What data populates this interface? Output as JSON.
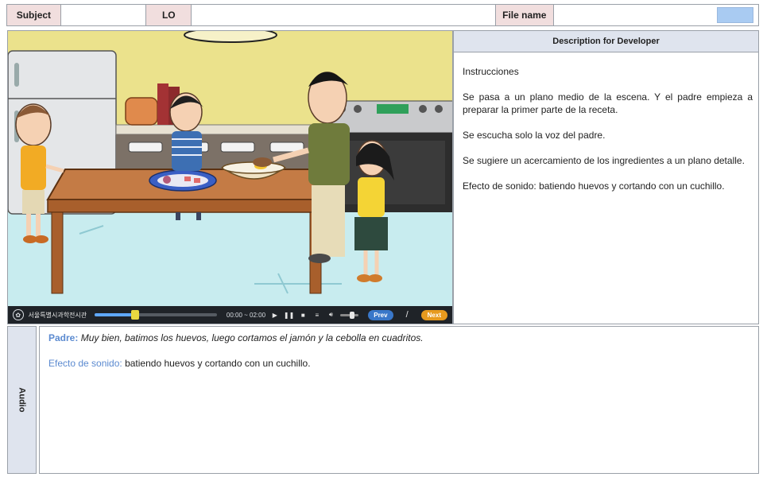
{
  "header": {
    "subject_label": "Subject",
    "lo_label": "LO",
    "filename_label": "File name"
  },
  "player": {
    "brand": "서울특별시과학전시관",
    "time": "00:00 ~ 02:00",
    "progress": 0.32,
    "prev_label": "Prev",
    "separator": "/",
    "next_label": "Next"
  },
  "description": {
    "heading": "Description for Developer",
    "paragraphs": [
      "Instrucciones",
      "Se pasa a un plano medio de la escena. Y el padre empieza a preparar  la primer parte de la receta.",
      "Se escucha solo la voz del padre.",
      "Se sugiere un acercamiento de los ingredientes a un plano detalle.",
      "Efecto de sonido:  batiendo huevos y cortando con un cuchillo."
    ]
  },
  "audio": {
    "tab_label": "Audio",
    "speaker": "Padre:",
    "line": " Muy bien, batimos los huevos, luego cortamos el jamón y la cebolla en cuadritos.",
    "sfx_label": "Efecto de sonido:",
    "sfx_text": "  batiendo huevos y cortando con un cuchillo."
  },
  "colors": {
    "header_label_bg": "#f1dede",
    "panel_header_bg": "#dfe4ee",
    "swatch": "#a9cbf2",
    "accent_text": "#5b8ad0",
    "prev_button": "#3977c9",
    "next_button": "#e79a1e"
  }
}
